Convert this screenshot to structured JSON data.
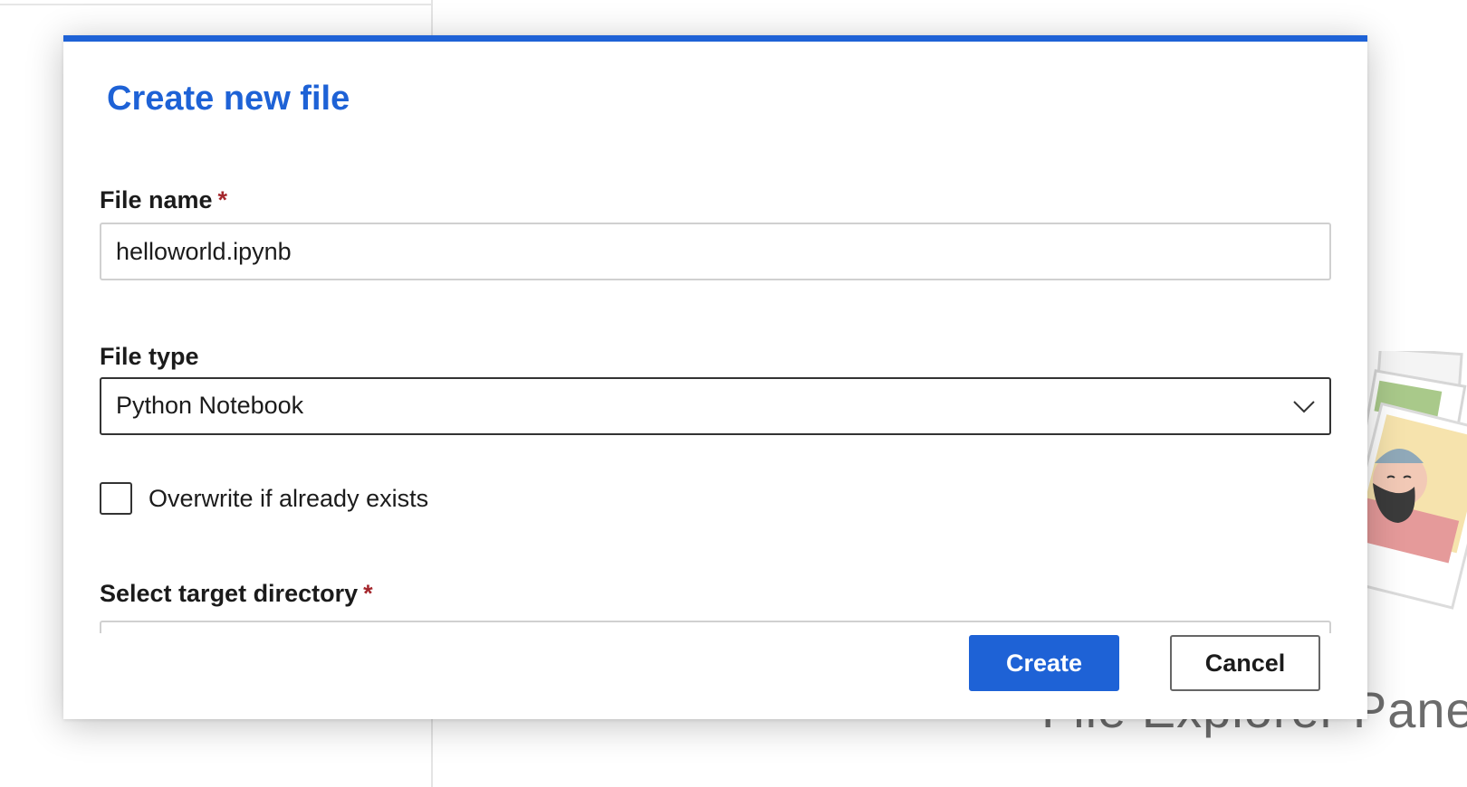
{
  "background": {
    "pane_title": "File Explorer Pane"
  },
  "dialog": {
    "title": "Create new file",
    "file_name": {
      "label": "File name",
      "required_mark": "*",
      "value": "helloworld.ipynb"
    },
    "file_type": {
      "label": "File type",
      "selected": "Python Notebook",
      "chevron_icon": "chevron-down-icon"
    },
    "overwrite": {
      "label": "Overwrite if already exists",
      "checked": false
    },
    "target_directory": {
      "label": "Select target directory",
      "required_mark": "*"
    },
    "buttons": {
      "create": "Create",
      "cancel": "Cancel"
    },
    "colors": {
      "accent": "#1e62d6",
      "required": "#a4262c"
    }
  }
}
